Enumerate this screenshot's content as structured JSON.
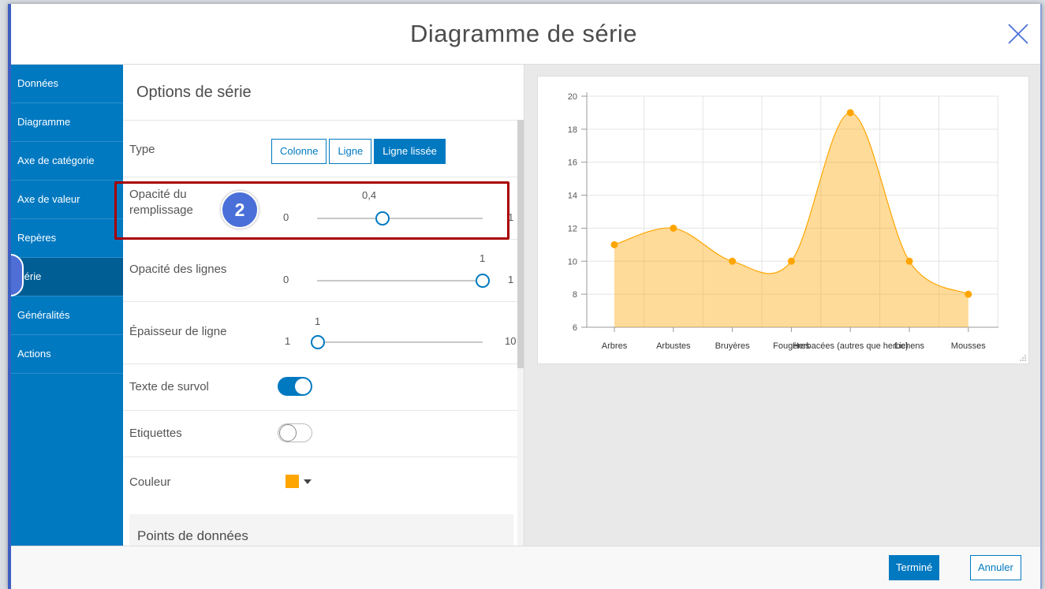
{
  "dialog": {
    "title": "Diagramme de série"
  },
  "sidebar": {
    "items": [
      {
        "label": "Données",
        "active": false
      },
      {
        "label": "Diagramme",
        "active": false
      },
      {
        "label": "Axe de catégorie",
        "active": false
      },
      {
        "label": "Axe de valeur",
        "active": false
      },
      {
        "label": "Repères",
        "active": false
      },
      {
        "label": "Série",
        "active": true
      },
      {
        "label": "Généralités",
        "active": false
      },
      {
        "label": "Actions",
        "active": false
      }
    ]
  },
  "options": {
    "header": "Options de série",
    "type": {
      "label": "Type",
      "buttons": [
        "Colonne",
        "Ligne",
        "Ligne lissée"
      ],
      "selected": "Ligne lissée"
    },
    "fill_opacity": {
      "label_line1": "Opacité du",
      "label_line2": "remplissage",
      "min": "0",
      "max": "1",
      "value": "0,4",
      "fraction": 0.4
    },
    "line_opacity": {
      "label": "Opacité des lignes",
      "min": "0",
      "max": "1",
      "value": "1",
      "fraction": 1.0
    },
    "line_width": {
      "label": "Épaisseur de ligne",
      "min": "1",
      "max": "10",
      "value": "1",
      "fraction": 0.0
    },
    "hover_text": {
      "label": "Texte de survol",
      "on": true
    },
    "labels": {
      "label": "Etiquettes",
      "on": false
    },
    "color": {
      "label": "Couleur",
      "value": "#ffa500"
    },
    "data_points_section": "Points de données",
    "step_badge": "2"
  },
  "colors": {
    "accent": "#0079c1",
    "series": "#ffa500",
    "highlight": "#a80000"
  },
  "chart_data": {
    "type": "area",
    "smooth": true,
    "categories": [
      "Arbres",
      "Arbustes",
      "Bruyères",
      "Fougères",
      "Herbacées (autres que herbe)",
      "Lichens",
      "Mousses"
    ],
    "x_positions": [
      0,
      1,
      2,
      3,
      4,
      5,
      6
    ],
    "values": [
      11,
      12,
      10,
      10,
      19,
      10,
      8
    ],
    "ylim": [
      6,
      20
    ],
    "yticks": [
      "6",
      "8",
      "10",
      "12",
      "14",
      "16",
      "18",
      "20"
    ],
    "grid": true,
    "fill_opacity": 0.4
  },
  "footer": {
    "done": "Terminé",
    "cancel": "Annuler"
  }
}
